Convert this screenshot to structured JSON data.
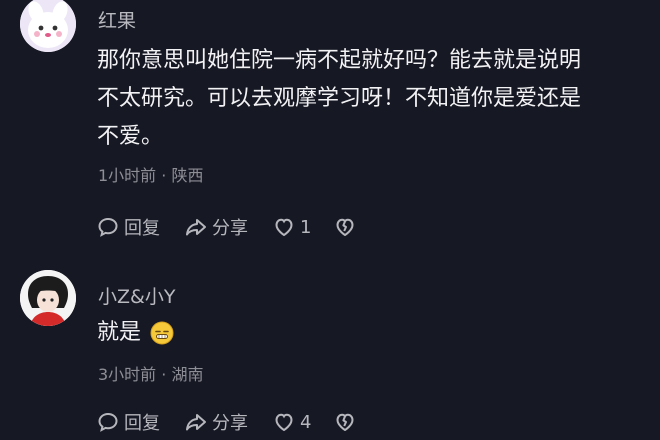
{
  "comments": [
    {
      "username": "红果",
      "text_line1": "那你意思叫她住院一病不起就好吗？能去就是说明",
      "text_line2": "不太研究。可以去观摩学习呀！不知道你是爱还是",
      "text_line3": "不爱。",
      "meta": "1小时前 · 陕西",
      "reply_label": "回复",
      "share_label": "分享",
      "like_count": "1"
    },
    {
      "username": "小Z&小Y",
      "text": "就是",
      "meta": "3小时前 · 湖南",
      "reply_label": "回复",
      "share_label": "分享",
      "like_count": "4"
    }
  ],
  "icons": {
    "reply": "speech-bubble-icon",
    "share": "share-arrow-icon",
    "like": "heart-icon",
    "dislike": "broken-heart-icon",
    "emoji": "awkward-smile-emoji-icon"
  }
}
